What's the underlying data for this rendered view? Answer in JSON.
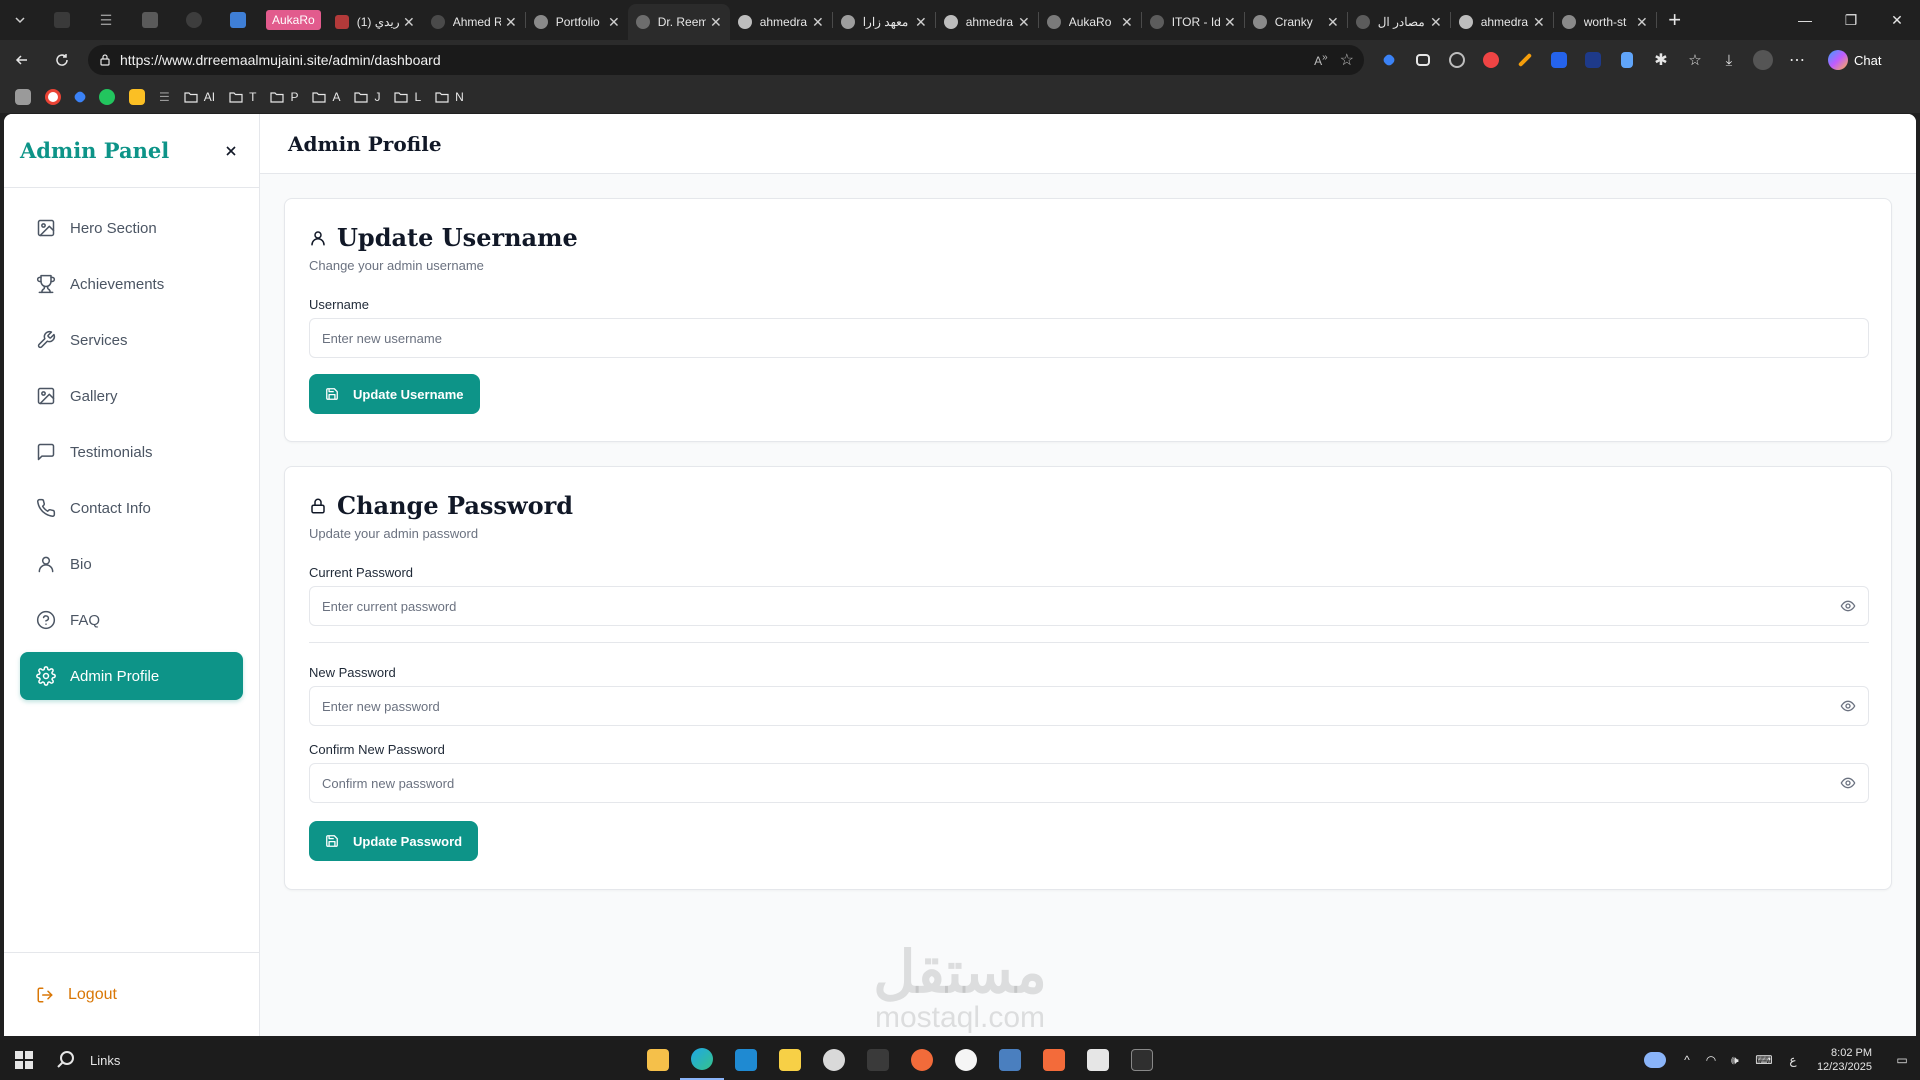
{
  "browser": {
    "tabs": [
      {
        "label": "Ahmed R",
        "fav_color": "#4a4a4a"
      },
      {
        "label": "Portfolio",
        "fav_color": "#8a8a8a"
      },
      {
        "label": "Dr. Reem",
        "fav_color": "#6d6d6d",
        "active": true
      },
      {
        "label": "ahmedra",
        "fav_color": "#bdbdbd"
      },
      {
        "label": "معهد زارا",
        "fav_color": "#9e9e9e"
      },
      {
        "label": "ahmedra",
        "fav_color": "#bdbdbd"
      },
      {
        "label": "AukaRo",
        "fav_color": "#7a7a7a"
      },
      {
        "label": "ITOR - Id",
        "fav_color": "#5c5c5c"
      },
      {
        "label": "Cranky",
        "fav_color": "#8a8a8a"
      },
      {
        "label": "مصادر ال",
        "fav_color": "#5c5c5c"
      },
      {
        "label": "ahmedra",
        "fav_color": "#bdbdbd"
      },
      {
        "label": "worth-st",
        "fav_color": "#8a8a8a"
      }
    ],
    "pinned_badge": "AukaRo",
    "pinned_tab_label": "(1) فريدي",
    "url": "https://www.drreemaalmujaini.site/admin/dashboard",
    "chat_label": "Chat",
    "bookmarks": [
      {
        "label": "AI"
      },
      {
        "label": "T"
      },
      {
        "label": "P"
      },
      {
        "label": "A"
      },
      {
        "label": "J"
      },
      {
        "label": "L"
      },
      {
        "label": "N"
      }
    ]
  },
  "sidebar": {
    "title": "Admin Panel",
    "items": [
      {
        "label": "Hero Section",
        "icon": "image-icon"
      },
      {
        "label": "Achievements",
        "icon": "trophy-icon"
      },
      {
        "label": "Services",
        "icon": "wrench-icon"
      },
      {
        "label": "Gallery",
        "icon": "image-icon"
      },
      {
        "label": "Testimonials",
        "icon": "message-square-icon"
      },
      {
        "label": "Contact Info",
        "icon": "phone-icon"
      },
      {
        "label": "Bio",
        "icon": "user-icon"
      },
      {
        "label": "FAQ",
        "icon": "help-circle-icon"
      },
      {
        "label": "Admin Profile",
        "icon": "gear-icon",
        "active": true
      }
    ],
    "logout_label": "Logout"
  },
  "header": {
    "title": "Admin Profile"
  },
  "username_card": {
    "title": "Update Username",
    "subtitle": "Change your admin username",
    "field_label": "Username",
    "placeholder": "Enter new username",
    "button_label": "Update Username"
  },
  "password_card": {
    "title": "Change Password",
    "subtitle": "Update your admin password",
    "current_label": "Current Password",
    "current_placeholder": "Enter current password",
    "new_label": "New Password",
    "new_placeholder": "Enter new password",
    "confirm_label": "Confirm New Password",
    "confirm_placeholder": "Confirm new password",
    "button_label": "Update Password"
  },
  "watermark": {
    "arabic": "مستقل",
    "latin": "mostaql.com"
  },
  "taskbar": {
    "search_label": "Links",
    "time": "8:02 PM",
    "date": "12/23/2025",
    "lang": "ع"
  },
  "colors": {
    "accent": "#0d9488",
    "logout": "#d97706",
    "brand": "#0d9488"
  }
}
